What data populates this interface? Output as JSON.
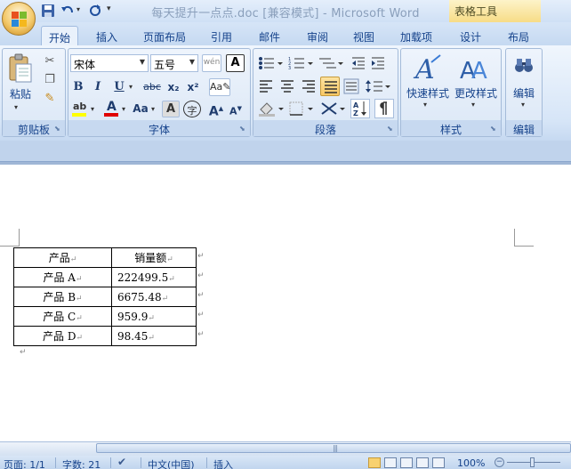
{
  "window": {
    "title": "每天提升一点点.doc [兼容模式] - Microsoft Word",
    "context_tools": "表格工具"
  },
  "quick_access": {
    "save_icon": "save-icon",
    "undo_icon": "undo-icon",
    "redo_icon": "redo-icon",
    "customize_icon": "customize-icon"
  },
  "tabs": [
    "开始",
    "插入",
    "页面布局",
    "引用",
    "邮件",
    "审阅",
    "视图",
    "加载项",
    "设计",
    "布局"
  ],
  "ribbon": {
    "clipboard": {
      "label": "剪贴板",
      "paste": "粘贴"
    },
    "font": {
      "label": "字体",
      "font_name": "宋体",
      "font_size": "五号",
      "bold": "B",
      "italic": "I",
      "underline": "U",
      "strike": "abc",
      "sub": "x₂",
      "sup": "x²",
      "aa": "Aa",
      "grow": "A",
      "shrink": "A",
      "highlight_color": "#ffff00",
      "font_color": "#e00000"
    },
    "paragraph": {
      "label": "段落"
    },
    "styles": {
      "label": "样式",
      "quick_styles": "快速样式",
      "change_styles": "更改样式"
    },
    "editing": {
      "label": "编辑",
      "button": "编辑"
    }
  },
  "document": {
    "table": {
      "headers": [
        "产品",
        "销量额"
      ],
      "rows": [
        [
          "产品 A",
          "222499.5"
        ],
        [
          "产品 B",
          "6675.48"
        ],
        [
          "产品 C",
          "959.9"
        ],
        [
          "产品 D",
          "98.45"
        ]
      ]
    }
  },
  "statusbar": {
    "page": "页面: 1/1",
    "words": "字数: 21",
    "language": "中文(中国)",
    "mode": "插入",
    "zoom": "100%"
  }
}
